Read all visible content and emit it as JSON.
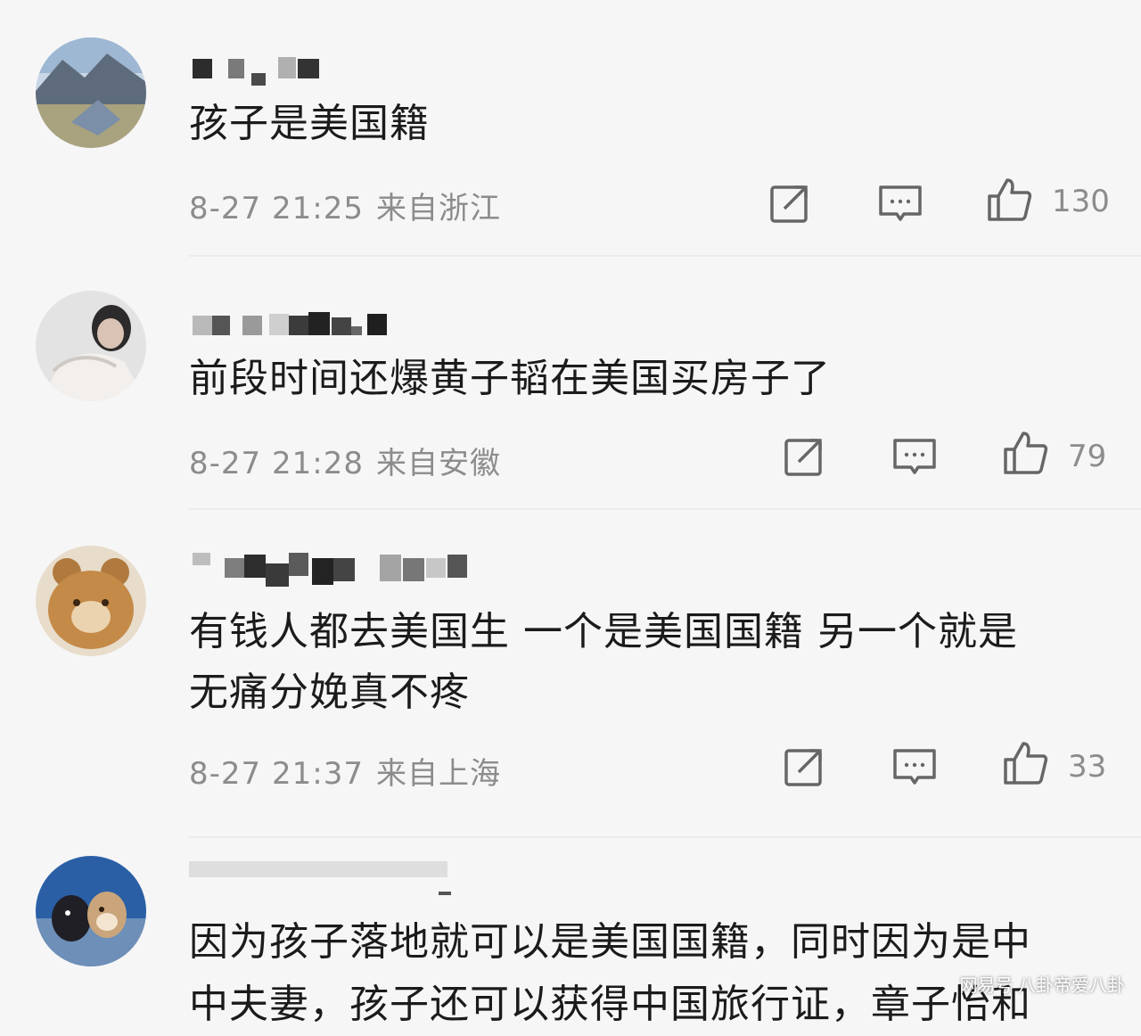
{
  "comments": [
    {
      "text": "孩子是美国籍",
      "time": "8-27 21:25",
      "location": "来自浙江",
      "likes": "130"
    },
    {
      "text": "前段时间还爆黄子韬在美国买房子了",
      "time": "8-27 21:28",
      "location": "来自安徽",
      "likes": "79"
    },
    {
      "text_line1": "有钱人都去美国生 一个是美国国籍 另一个就是",
      "text_line2": "无痛分娩真不疼",
      "time": "8-27 21:37",
      "location": "来自上海",
      "likes": "33"
    },
    {
      "text_line1": "因为孩子落地就可以是美国国籍，同时因为是中",
      "text_line2": "中夫妻，孩子还可以获得中国旅行证，章子怡和"
    }
  ],
  "icons": {
    "repost": "share-edit-icon",
    "comment": "comment-bubble-icon",
    "like": "thumbs-up-icon"
  },
  "watermark": "网易号 八卦帝爱八卦",
  "colors": {
    "background": "#f6f6f6",
    "text": "#1b1b1b",
    "meta": "#8c8c8c"
  }
}
